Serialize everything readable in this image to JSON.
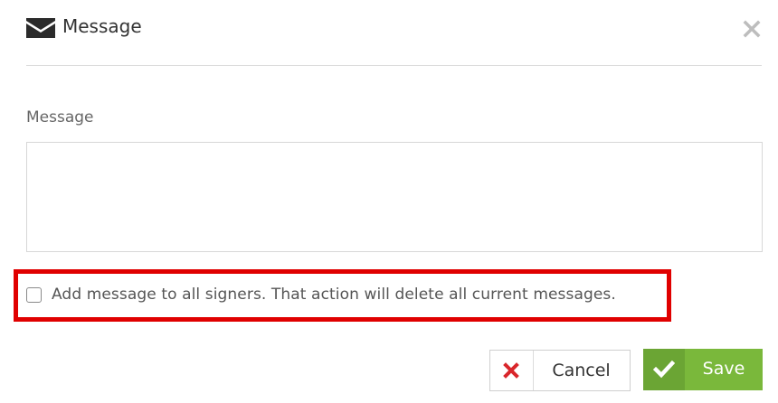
{
  "header": {
    "title": "Message",
    "icon": "envelope-icon",
    "close_icon": "close-icon"
  },
  "form": {
    "message_label": "Message",
    "message_value": "",
    "message_placeholder": ""
  },
  "checkbox": {
    "label": "Add message to all signers. That action will delete all current messages.",
    "checked": false,
    "highlight_color": "#e00000"
  },
  "buttons": {
    "cancel_label": "Cancel",
    "cancel_icon": "x-icon",
    "cancel_icon_color": "#d9262b",
    "save_label": "Save",
    "save_icon": "check-icon",
    "save_color": "#7ab83b"
  }
}
